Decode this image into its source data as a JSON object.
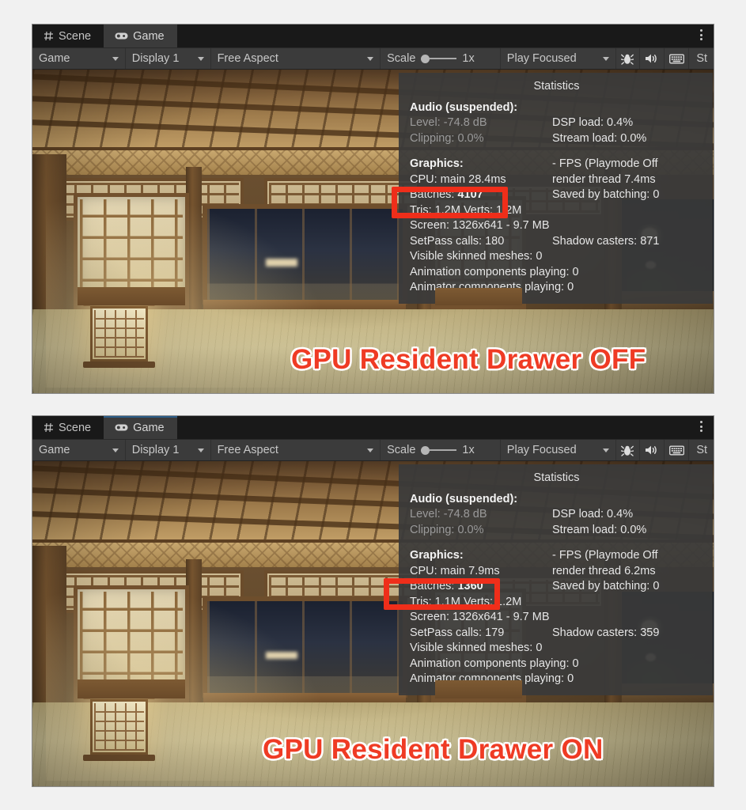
{
  "panels": [
    {
      "id": "top",
      "tabs": [
        {
          "label": "Scene",
          "icon": "grid-icon",
          "active": false
        },
        {
          "label": "Game",
          "icon": "gamepad-icon",
          "active": true,
          "focused": false
        }
      ],
      "toolbar": {
        "view_mode": "Game",
        "display": "Display 1",
        "aspect": "Free Aspect",
        "scale_label": "Scale",
        "scale_value": "1x",
        "play_mode": "Play Focused",
        "mute_icon": "speaker-icon",
        "debug_icon": "bug-icon",
        "stats_icon": "keyboard-icon",
        "stats_label": "St"
      },
      "statistics": {
        "title": "Statistics",
        "audio_header": "Audio (suspended):",
        "level": "Level: -74.8 dB",
        "clipping": "Clipping: 0.0%",
        "dsp_load": "DSP load: 0.4%",
        "stream_load": "Stream load: 0.0%",
        "graphics_header": "Graphics:",
        "fps": "- FPS (Playmode Off",
        "cpu_main": "CPU: main 28.4ms",
        "render_thread": "render thread 7.4ms",
        "batches_label": "Batches:",
        "batches_value": "4107",
        "saved_by_batching": "Saved by batching: 0",
        "tris_verts": "Tris: 1.2M Verts: 1.2M",
        "screen": "Screen: 1326x641 - 9.7 MB",
        "setpass": "SetPass calls: 180",
        "shadow_casters": "Shadow casters: 871",
        "skinned_meshes": "Visible skinned meshes: 0",
        "animation_components": "Animation components playing: 0",
        "animator_components": "Animator components playing: 0"
      },
      "caption": "GPU Resident Drawer OFF"
    },
    {
      "id": "bottom",
      "tabs": [
        {
          "label": "Scene",
          "icon": "grid-icon",
          "active": false
        },
        {
          "label": "Game",
          "icon": "gamepad-icon",
          "active": true,
          "focused": true
        }
      ],
      "toolbar": {
        "view_mode": "Game",
        "display": "Display 1",
        "aspect": "Free Aspect",
        "scale_label": "Scale",
        "scale_value": "1x",
        "play_mode": "Play Focused",
        "mute_icon": "speaker-icon",
        "debug_icon": "bug-icon",
        "stats_icon": "keyboard-icon",
        "stats_label": "St"
      },
      "statistics": {
        "title": "Statistics",
        "audio_header": "Audio (suspended):",
        "level": "Level: -74.8 dB",
        "clipping": "Clipping: 0.0%",
        "dsp_load": "DSP load: 0.4%",
        "stream_load": "Stream load: 0.0%",
        "graphics_header": "Graphics:",
        "fps": "- FPS (Playmode Off",
        "cpu_main": "CPU: main 7.9ms",
        "render_thread": "render thread 6.2ms",
        "batches_label": "Batches:",
        "batches_value": "1360",
        "saved_by_batching": "Saved by batching: 0",
        "tris_verts": "Tris: 1.1M Verts: 1.2M",
        "screen": "Screen: 1326x641 - 9.7 MB",
        "setpass": "SetPass calls: 179",
        "shadow_casters": "Shadow casters: 359",
        "skinned_meshes": "Visible skinned meshes: 0",
        "animation_components": "Animation components playing: 0",
        "animator_components": "Animator components playing: 0"
      },
      "caption": "GPU Resident Drawer ON"
    }
  ],
  "colors": {
    "highlight_red": "#ef2e1a",
    "caption_red": "#ef3b24",
    "panel_bg": "#3b3b3b",
    "tabbar_bg": "#191919",
    "focus_blue": "#2c5d87",
    "page_bg": "#f1f1f1"
  }
}
